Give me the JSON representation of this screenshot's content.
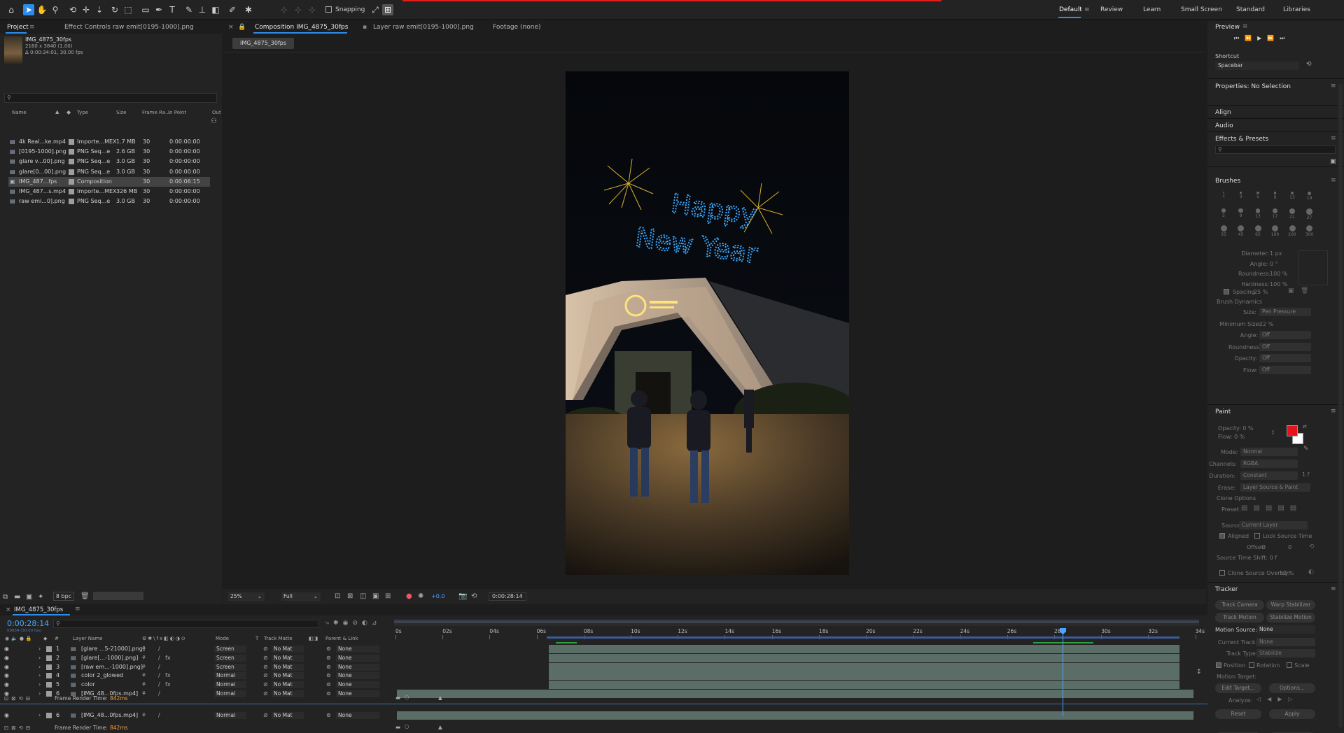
{
  "toolbar": {
    "snapping_label": "Snapping",
    "workspaces": [
      "Default",
      "Review",
      "Learn",
      "Small Screen",
      "Standard",
      "Libraries"
    ],
    "active_workspace": "Default"
  },
  "project_panel": {
    "tab_project": "Project",
    "tab_effect_controls": "Effect Controls raw emit[0195-1000].png",
    "selected_item": {
      "name": "IMG_4875_30fps",
      "dimensions": "2160 x 3840 (1.00)",
      "duration": "Δ 0:00:34:01, 30.00 fps"
    },
    "search_placeholder": "",
    "columns": [
      "Name",
      "Type",
      "Size",
      "Frame Ra...",
      "In Point",
      "Out"
    ],
    "items": [
      {
        "name": "4k Real...ke.mp4",
        "type": "Importe...MEX",
        "size": "1.7 MB",
        "fps": "30",
        "in": "0:00:00:00",
        "icon": "footage-icon"
      },
      {
        "name": "[0195-1000].png",
        "type": "PNG Seq...e",
        "size": "2.6 GB",
        "fps": "30",
        "in": "0:00:00:00",
        "icon": "footage-icon"
      },
      {
        "name": "glare v...00].png",
        "type": "PNG Seq...e",
        "size": "3.0 GB",
        "fps": "30",
        "in": "0:00:00:00",
        "icon": "footage-icon"
      },
      {
        "name": "glare[0...00].png",
        "type": "PNG Seq...e",
        "size": "3.0 GB",
        "fps": "30",
        "in": "0:00:00:00",
        "icon": "footage-icon"
      },
      {
        "name": "IMG_487...fps",
        "type": "Composition",
        "size": "",
        "fps": "30",
        "in": "0:00:06:15",
        "icon": "composition-icon"
      },
      {
        "name": "IMG_487...s.mp4",
        "type": "Importe...MEX",
        "size": "326 MB",
        "fps": "30",
        "in": "0:00:00:00",
        "icon": "footage-icon"
      },
      {
        "name": "raw emi...0].png",
        "type": "PNG Seq...e",
        "size": "3.0 GB",
        "fps": "30",
        "in": "0:00:00:00",
        "icon": "footage-icon"
      }
    ],
    "selected_index": 4,
    "bpc_label": "8 bpc"
  },
  "viewer": {
    "tab_composition": "Composition IMG_4875_30fps",
    "tab_layer": "Layer raw emit[0195-1000].png",
    "tab_footage": "Footage (none)",
    "comp_button": "IMG_4875_30fps",
    "zoom": "25%",
    "resolution": "Full",
    "exposure": "+0.0",
    "timecode": "0:00:28:14",
    "sky_text_line1": "Happy",
    "sky_text_line2": "New Year"
  },
  "right_panels": {
    "preview": "Preview",
    "shortcut_label": "Shortcut",
    "shortcut_value": "Spacebar",
    "properties": "Properties: No Selection",
    "align": "Align",
    "audio": "Audio",
    "effects_presets": "Effects & Presets",
    "brushes": "Brushes",
    "brush_sizes": [
      "1",
      "3",
      "5",
      "9",
      "13",
      "19",
      "5",
      "9",
      "13",
      "17",
      "21",
      "27",
      "35",
      "45",
      "65",
      "100",
      "200",
      "300"
    ],
    "brush_props": [
      {
        "label": "Diameter:",
        "value": "1 px"
      },
      {
        "label": "Angle:",
        "value": "0 °"
      },
      {
        "label": "Roundness:",
        "value": "100 %"
      },
      {
        "label": "Hardness:",
        "value": "100 %"
      }
    ],
    "spacing_label": "Spacing:",
    "spacing_value": "25 %",
    "brush_dynamics": "Brush Dynamics",
    "dyn_rows": [
      {
        "label": "Size:",
        "value": "Pen Pressure"
      },
      {
        "label": "Minimum Size:",
        "value": "22 %"
      },
      {
        "label": "Angle:",
        "value": "Off"
      },
      {
        "label": "Roundness:",
        "value": "Off"
      },
      {
        "label": "Opacity:",
        "value": "Off"
      },
      {
        "label": "Flow:",
        "value": "Off"
      }
    ],
    "paint": "Paint",
    "paint_opacity": "Opacity: 0 %",
    "paint_flow": "Flow: 0 %",
    "paint_rows": [
      {
        "label": "Mode:",
        "value": "Normal"
      },
      {
        "label": "Channels:",
        "value": "RGBA"
      },
      {
        "label": "Duration:",
        "value": "Constant"
      },
      {
        "label": "Erase:",
        "value": "Layer Source & Paint"
      }
    ],
    "duration_extra": "1 f",
    "clone_options": "Clone Options",
    "preset_label": "Preset:",
    "source_label": "Source:",
    "source_value": "Current Layer",
    "aligned": "Aligned",
    "lock_source_time": "Lock Source Time",
    "offset_label": "Offset:",
    "offset_x": "0",
    "offset_y": "0",
    "source_time_shift": "Source Time Shift: 0 f",
    "clone_overlay": "Clone Source Overlay:",
    "clone_overlay_value": "50 %",
    "tracker": "Tracker",
    "track_camera": "Track Camera",
    "warp_stabilizer": "Warp Stabilizer",
    "track_motion": "Track Motion",
    "stabilize_motion": "Stabilize Motion",
    "motion_source_label": "Motion Source:",
    "motion_source_value": "None",
    "current_track_label": "Current Track:",
    "current_track_value": "None",
    "track_type_label": "Track Type:",
    "track_type_value": "Stabilize",
    "position": "Position",
    "rotation": "Rotation",
    "scale": "Scale",
    "motion_target": "Motion Target:",
    "edit_target": "Edit Target...",
    "options": "Options...",
    "analyze": "Analyze:",
    "reset": "Reset",
    "apply": "Apply",
    "colors": {
      "foreground": "#e3141b",
      "background": "#ffffff"
    }
  },
  "timeline": {
    "tab": "IMG_4875_30fps",
    "timecode": "0:00:28:14",
    "timecode_sub": "00854 (30.00 fps)",
    "columns": {
      "layer_name": "Layer Name",
      "mode": "Mode",
      "t": "T",
      "track_matte": "Track Matte",
      "parent": "Parent & Link"
    },
    "ruler": [
      "0s",
      "02s",
      "04s",
      "06s",
      "08s",
      "10s",
      "12s",
      "14s",
      "16s",
      "18s",
      "20s",
      "22s",
      "24s",
      "26s",
      "28s",
      "30s",
      "32s",
      "34s"
    ],
    "layers": [
      {
        "num": "1",
        "name": "[glare ...5-21000].png]",
        "mode": "Screen",
        "matte": "No Mat",
        "parent": "None",
        "fx": false
      },
      {
        "num": "2",
        "name": "[glare[...-1000].png]",
        "mode": "Screen",
        "matte": "No Mat",
        "parent": "None",
        "fx": true
      },
      {
        "num": "3",
        "name": "[raw em...-1000].png]",
        "mode": "Screen",
        "matte": "No Mat",
        "parent": "None",
        "fx": false
      },
      {
        "num": "4",
        "name": "color 2_glowed",
        "mode": "Normal",
        "matte": "No Mat",
        "parent": "None",
        "fx": true
      },
      {
        "num": "5",
        "name": "color",
        "mode": "Normal",
        "matte": "No Mat",
        "parent": "None",
        "fx": true
      },
      {
        "num": "6",
        "name": "[IMG_48...0fps.mp4]",
        "mode": "Normal",
        "matte": "No Mat",
        "parent": "None",
        "fx": false
      }
    ],
    "frame_render_label": "Frame Render Time:",
    "frame_render_value": "842ms",
    "bottom_layer": {
      "num": "6",
      "name": "[IMG_48...0fps.mp4]",
      "mode": "Normal",
      "matte": "No Mat",
      "parent": "None"
    }
  }
}
